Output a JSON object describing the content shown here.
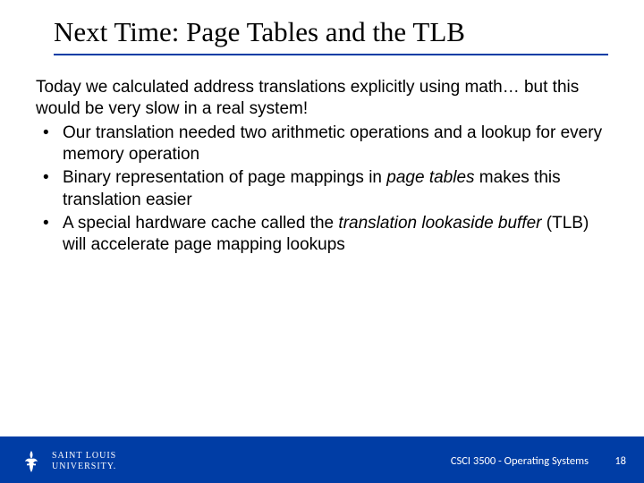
{
  "title": "Next Time: Page Tables and the TLB",
  "intro": "Today we calculated address translations explicitly using math… but this would be very slow in a real system!",
  "bullets": [
    {
      "pre": "Our translation needed two arithmetic operations and a lookup for every memory operation",
      "it": "",
      "post": ""
    },
    {
      "pre": "Binary representation of page mappings in ",
      "it": "page tables",
      "post": " makes this translation easier"
    },
    {
      "pre": "A special hardware cache called the ",
      "it": "translation lookaside buffer",
      "post": " (TLB) will accelerate page mapping lookups"
    }
  ],
  "footer": {
    "logo_line1": "SAINT LOUIS",
    "logo_line2": "UNIVERSITY.",
    "course": "CSCI 3500 - Operating Systems",
    "page": "18"
  },
  "colors": {
    "brand": "#003da5"
  }
}
